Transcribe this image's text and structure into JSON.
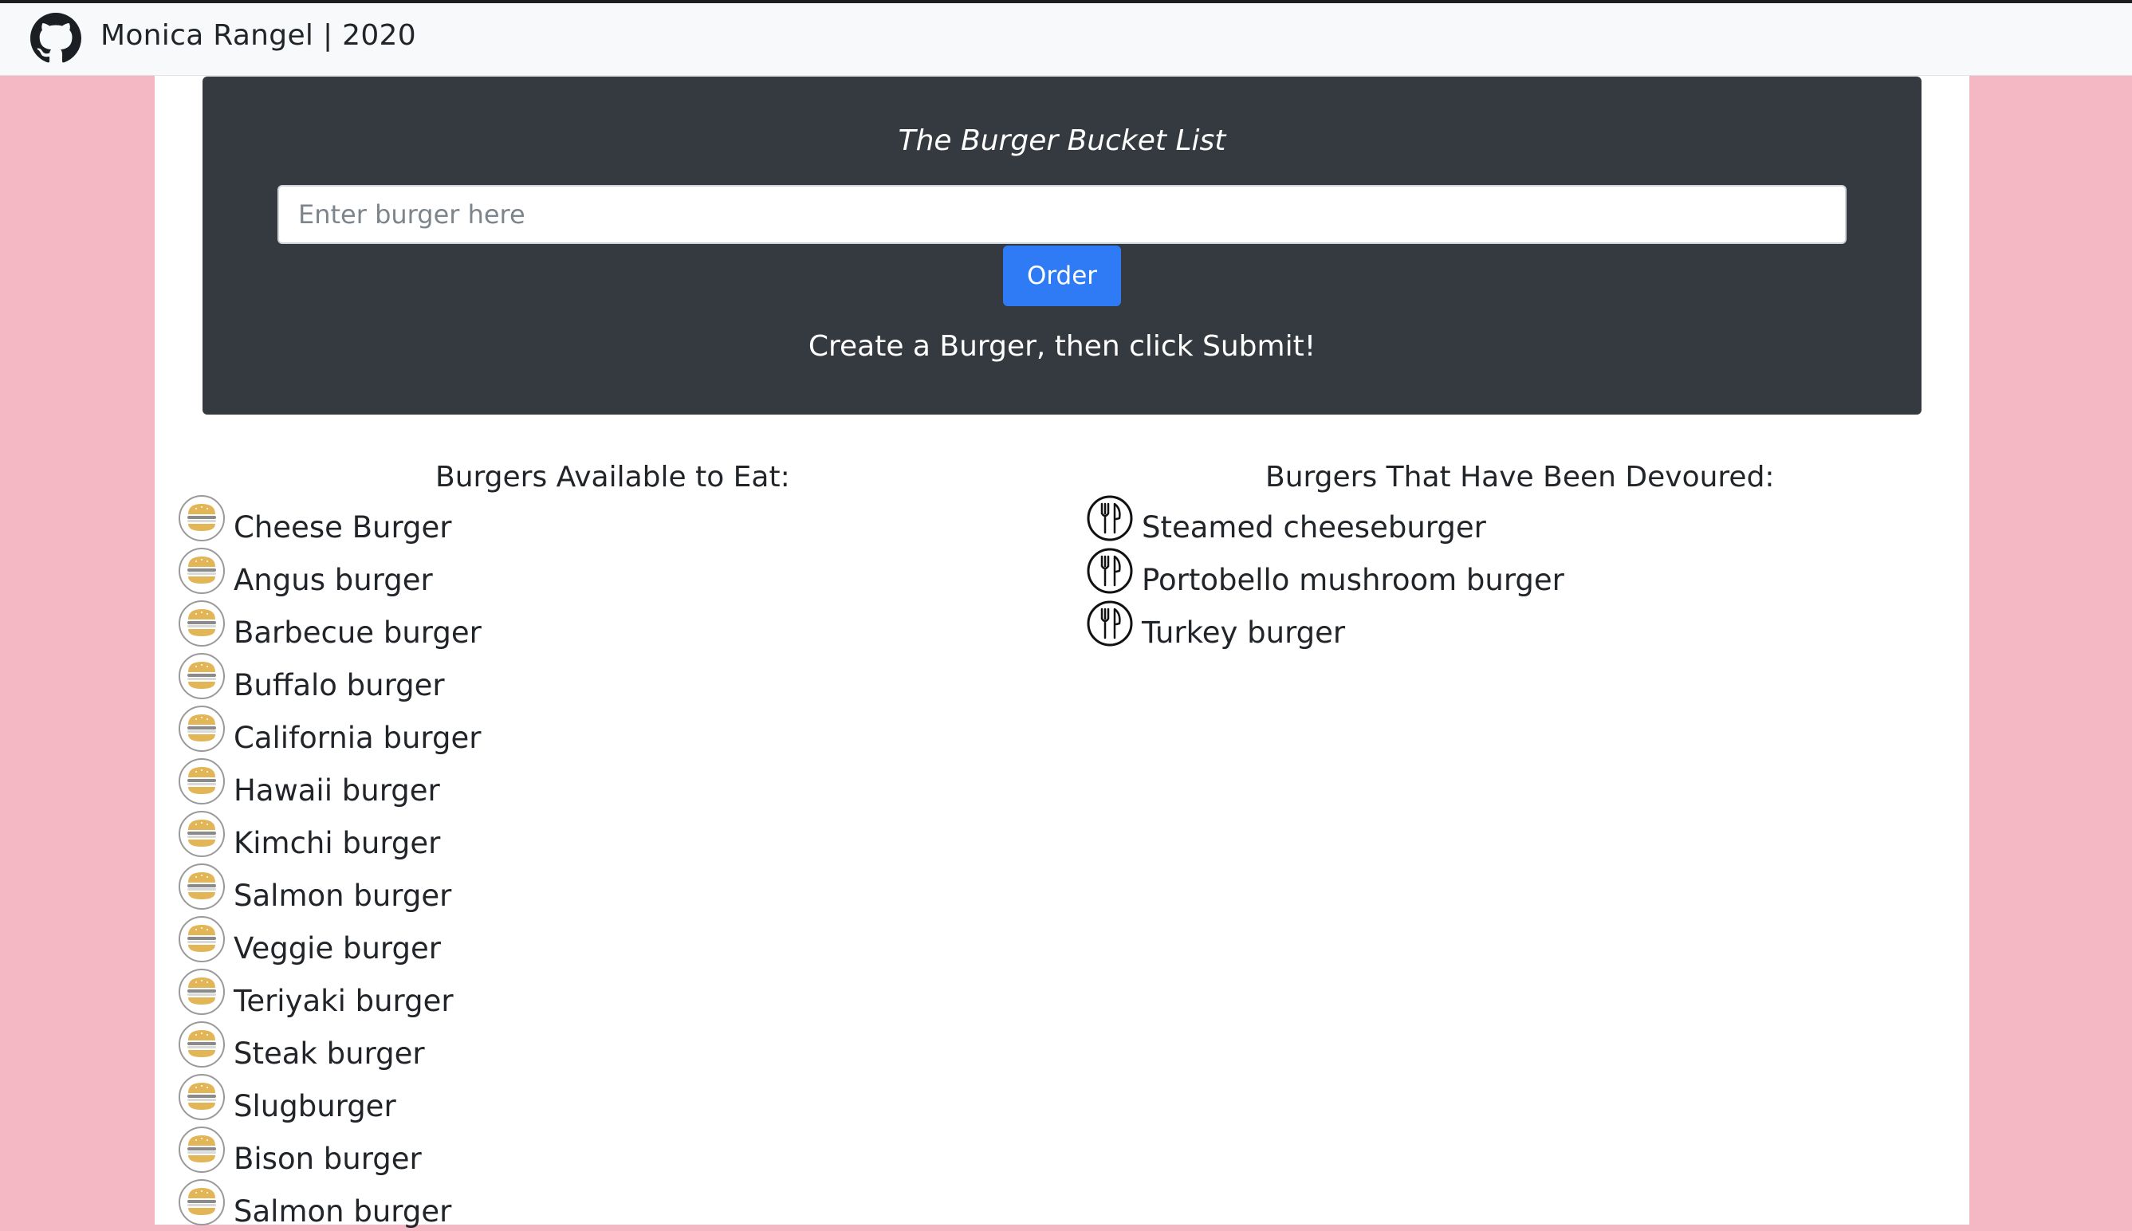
{
  "navbar": {
    "brand": "Monica Rangel | 2020",
    "icon": "github-icon"
  },
  "jumbotron": {
    "title": "The Burger Bucket List",
    "input_placeholder": "Enter burger here",
    "input_value": "",
    "order_label": "Order",
    "subtitle": "Create a Burger, then click Submit!"
  },
  "available": {
    "heading": "Burgers Available to Eat:",
    "icon": "burger-icon",
    "items": [
      "Cheese Burger",
      "Angus burger",
      "Barbecue burger",
      "Buffalo burger",
      "California burger",
      "Hawaii burger",
      "Kimchi burger",
      "Salmon burger",
      "Veggie burger",
      "Teriyaki burger",
      "Steak burger",
      "Slugburger",
      "Bison burger",
      "Salmon burger"
    ]
  },
  "devoured": {
    "heading": "Burgers That Have Been Devoured:",
    "icon": "fork-knife-icon",
    "items": [
      "Steamed cheeseburger",
      "Portobello mushroom burger",
      "Turkey burger"
    ]
  },
  "colors": {
    "page_background": "#f4b8c4",
    "jumbotron": "#343a40",
    "button": "#2f7bf5",
    "bun": "#e2b556"
  }
}
